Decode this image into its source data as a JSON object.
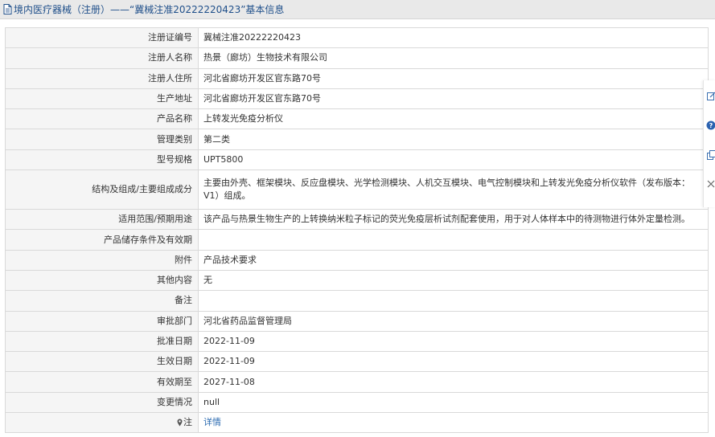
{
  "header": {
    "title": "境内医疗器械（注册）——“冀械注准20222220423”基本信息"
  },
  "rows": [
    {
      "label": "注册证编号",
      "value": "冀械注准20222220423"
    },
    {
      "label": "注册人名称",
      "value": "热景（廊坊）生物技术有限公司"
    },
    {
      "label": "注册人住所",
      "value": "河北省廊坊开发区官东路70号"
    },
    {
      "label": "生产地址",
      "value": "河北省廊坊开发区官东路70号"
    },
    {
      "label": "产品名称",
      "value": "上转发光免疫分析仪"
    },
    {
      "label": "管理类别",
      "value": "第二类"
    },
    {
      "label": "型号规格",
      "value": "UPT5800"
    },
    {
      "label": "结构及组成/主要组成成分",
      "value": "主要由外壳、框架模块、反应盘模块、光学检测模块、人机交互模块、电气控制模块和上转发光免疫分析仪软件（发布版本：V1）组成。"
    },
    {
      "label": "适用范围/预期用途",
      "value": "该产品与热景生物生产的上转换纳米粒子标记的荧光免疫层析试剂配套使用，用于对人体样本中的待测物进行体外定量检测。"
    },
    {
      "label": "产品储存条件及有效期",
      "value": ""
    },
    {
      "label": "附件",
      "value": "产品技术要求"
    },
    {
      "label": "其他内容",
      "value": "无"
    },
    {
      "label": "备注",
      "value": ""
    },
    {
      "label": "审批部门",
      "value": "河北省药品监督管理局"
    },
    {
      "label": "批准日期",
      "value": "2022-11-09"
    },
    {
      "label": "生效日期",
      "value": "2022-11-09"
    },
    {
      "label": "有效期至",
      "value": "2027-11-08"
    },
    {
      "label": "变更情况",
      "value": "null"
    },
    {
      "label": "注",
      "value": "详情"
    }
  ],
  "colors": {
    "header_bg": "#e9e9e9",
    "header_text": "#1f4f8a",
    "label_bg": "#f5f5f5",
    "border": "#d9d9d9",
    "link": "#2a6ab0"
  },
  "icons": [
    "document-icon",
    "pin-icon",
    "edit-icon",
    "help-icon",
    "copy-icon",
    "close-icon"
  ]
}
